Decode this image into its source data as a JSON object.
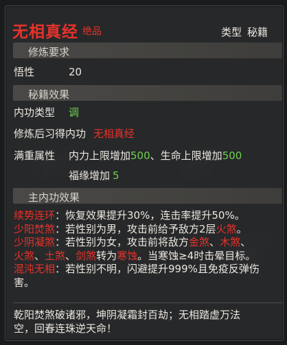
{
  "header": {
    "title": "无相真经",
    "grade": "绝品",
    "type_label": "类型",
    "type_value": "秘籍"
  },
  "sections": {
    "requirements": "修炼要求",
    "effects": "秘籍效果",
    "main_effects": "主内功效果"
  },
  "requirements": {
    "comprehension_label": "悟性",
    "comprehension_value": "20"
  },
  "book_effects": {
    "neigong_type_label": "内功类型",
    "neigong_type_value": "调",
    "learned_label": "修炼后习得内功",
    "learned_value": "无相真经",
    "full_attr_label": "满重属性",
    "attr1_label": "内力上限增加",
    "attr1_value": "500",
    "attr_sep": "、",
    "attr2_label": "生命上限增加",
    "attr2_value": "500",
    "attr3_label": "福缘增加",
    "attr3_value": "5"
  },
  "main_effects": {
    "e1_name": "续势连环",
    "e1_text": "：恢复效果提升30%，连击率提升50%。",
    "e2_name": "少阳焚煞",
    "e2_text_a": "：若性别为男，攻击前给予敌方2层",
    "e2_kw": "火煞",
    "e2_end": "。",
    "e3_name": "少阴凝煞",
    "e3_text_a": "：若性别为女，攻击前将敌方",
    "e3_kw1": "金煞",
    "e3_sep1": "、",
    "e3_kw2": "木煞",
    "e3_sep2": "、",
    "e3_kw3": "火煞",
    "e3_sep3": "、",
    "e3_kw4": "土煞",
    "e3_sep4": "、",
    "e3_kw5": "剑煞",
    "e3_text_b": "转为",
    "e3_kw6": "寒蚀",
    "e3_text_c": "。当寒蚀≥4时击晕目标。",
    "e4_name": "混沌无相",
    "e4_text_a": "：若性别不明，闪避提升999%且免疫反弹伤",
    "e4_text_b": "害。"
  },
  "flavor": {
    "line1": "乾阳焚煞破诸邪，坤阴凝霜封百劫；无相踏虚万法",
    "line2": "空，回春连珠逆天命！"
  },
  "colors": {
    "title_red": "#e8322a",
    "value_green": "#6fd14f",
    "section_bg": "#4a4947",
    "panel_bg": "#28292b"
  }
}
